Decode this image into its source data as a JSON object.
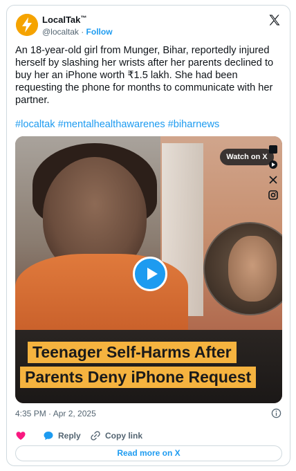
{
  "author": {
    "display_name": "LocalTak",
    "verified_mark": "™",
    "handle": "@localtak",
    "separator": " · ",
    "follow_label": "Follow",
    "avatar_icon": "lightning-bolt-logo"
  },
  "tweet": {
    "text": "An 18-year-old girl from Munger, Bihar, reportedly injured herself by slashing her wrists after her parents declined to buy her an iPhone worth ₹1.5 lakh. She had been requesting the phone for months to communicate with her partner.",
    "hashtags": "#localtak #mentalhealthawarenes #biharnews"
  },
  "media": {
    "watch_label": "Watch on X",
    "headline_line1": "Teenager Self-Harms After",
    "headline_line2": "Parents Deny iPhone Request",
    "side_icons": [
      "black-square-icon",
      "play-circle-icon",
      "crossed-icon",
      "instagram-icon"
    ],
    "play_icon": "play-icon"
  },
  "footer": {
    "timestamp": "4:35 PM · Apr 2, 2025",
    "actions": {
      "like_icon": "heart-icon",
      "reply_label": "Reply",
      "copy_link_label": "Copy link"
    },
    "read_more_label": "Read more on X"
  },
  "colors": {
    "link": "#1d9bf0",
    "secondary_text": "#536471",
    "like": "#f91880",
    "headline_bg": "#f5b33f"
  }
}
